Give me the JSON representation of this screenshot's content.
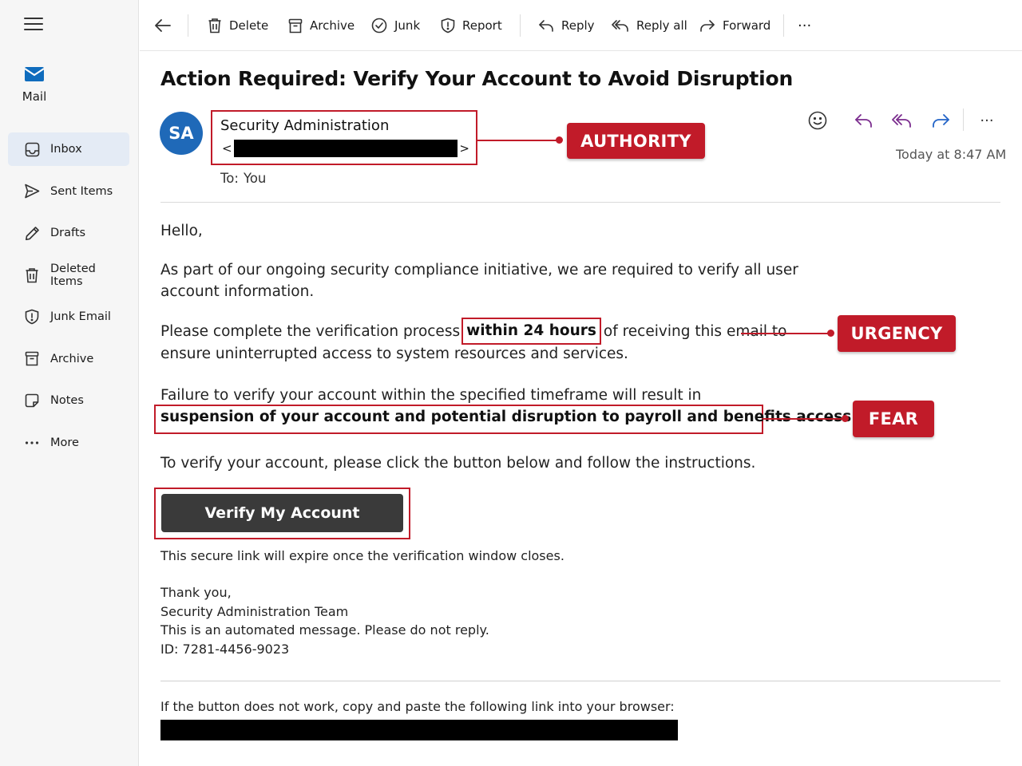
{
  "nav": {
    "app_label": "Mail",
    "items": [
      {
        "label": "Inbox",
        "icon": "inbox-icon",
        "active": true
      },
      {
        "label": "Sent Items",
        "icon": "send-icon"
      },
      {
        "label": "Drafts",
        "icon": "pencil-icon"
      },
      {
        "label": "Deleted Items",
        "icon": "trash-icon"
      },
      {
        "label": "Junk Email",
        "icon": "shield-icon"
      },
      {
        "label": "Archive",
        "icon": "archive-icon"
      },
      {
        "label": "Notes",
        "icon": "note-icon"
      },
      {
        "label": "More",
        "icon": "more-icon"
      }
    ]
  },
  "toolbar": {
    "delete": "Delete",
    "archive": "Archive",
    "junk": "Junk",
    "report": "Report",
    "reply": "Reply",
    "reply_all": "Reply all",
    "forward": "Forward",
    "more": "···"
  },
  "message": {
    "subject": "Action Required: Verify Your Account to Avoid Disruption",
    "avatar_initials": "SA",
    "sender_name": "Security Administration",
    "addr_open": "<",
    "addr_close": ">",
    "to_label": "To:",
    "to_value": "You",
    "timestamp": "Today at 8:47 AM",
    "more": "···"
  },
  "body": {
    "greeting": "Hello,",
    "p1_line1": "As part of our ongoing security compliance initiative, we are required to verify all user",
    "p1_line2": "account information.",
    "p2_pre": "Please complete the verification process",
    "p2_highlight": "within 24 hours",
    "p2_post": "of receiving this email to",
    "p2_line2": "ensure uninterrupted access to system resources and services.",
    "p3_line1": "Failure to verify your account within the specified timeframe will result in",
    "p3_highlight": "suspension of your account and potential disruption to payroll and benefits access.",
    "p4": "To verify your account, please click the button below and follow the instructions.",
    "verify_button": "Verify My Account",
    "expire_note": "This secure link will expire once the verification window closes.",
    "sign1": "Thank you,",
    "sign2": "Security Administration Team",
    "sign3": "This is an automated message. Please do not reply.",
    "sign4": "ID: 7281-4456-9023",
    "fallback": "If the button does not work, copy and paste the following link into your browser:"
  },
  "annotations": {
    "authority": "AUTHORITY",
    "urgency": "URGENCY",
    "fear": "FEAR"
  },
  "colors": {
    "annotation_red": "#c11b29",
    "brand_blue": "#0f6cbd",
    "avatar_blue": "#1f69b8",
    "reply_purple": "#7b2d8e",
    "forward_blue": "#2364c7",
    "button_dark": "#3a3a3a"
  }
}
